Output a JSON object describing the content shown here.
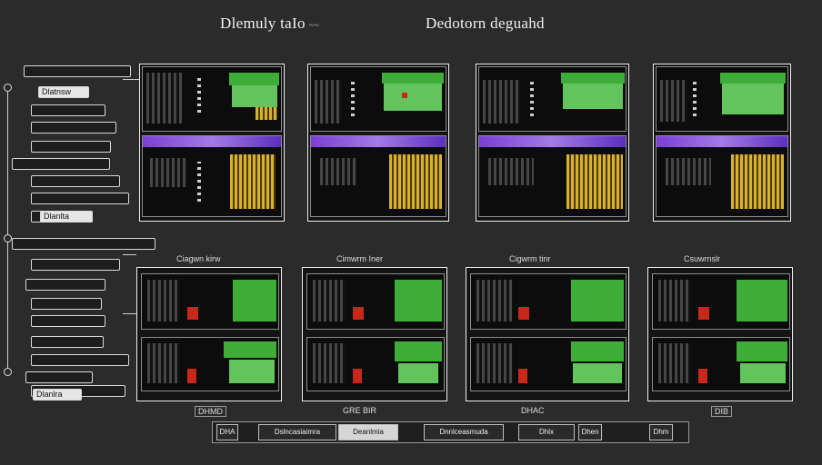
{
  "header": {
    "title_left": "Dlemuly taIo",
    "title_left_suffix": "~~",
    "title_right": "Dedotorn deguahd"
  },
  "sidebar": {
    "top_items": [
      "",
      "Dlatnsw",
      "",
      "",
      "",
      "",
      "",
      "",
      "",
      "Dlanlta"
    ],
    "bottom_items": [
      "",
      "",
      "",
      "",
      "",
      "",
      "",
      "",
      "",
      "Dlanlra"
    ]
  },
  "row2_captions": [
    "Ciagwn kirw",
    "Cimwrm Iner",
    "Cigwrm tinr",
    "Csuwrnslr"
  ],
  "below_captions": [
    "DHMD",
    "GRE BIR",
    "DHAC",
    "DIB"
  ],
  "bottom_buttons": [
    "DHA",
    "Dslncasiaimra",
    "Deanlmia",
    "Dnnlceasmuda",
    "Dhlx",
    "Dhen",
    "Dhm"
  ],
  "colors": {
    "background": "#2b2b2c",
    "green": "#3fae38",
    "purple": "#8a52de",
    "yellow": "#d9b22c",
    "red": "#c8271b"
  }
}
